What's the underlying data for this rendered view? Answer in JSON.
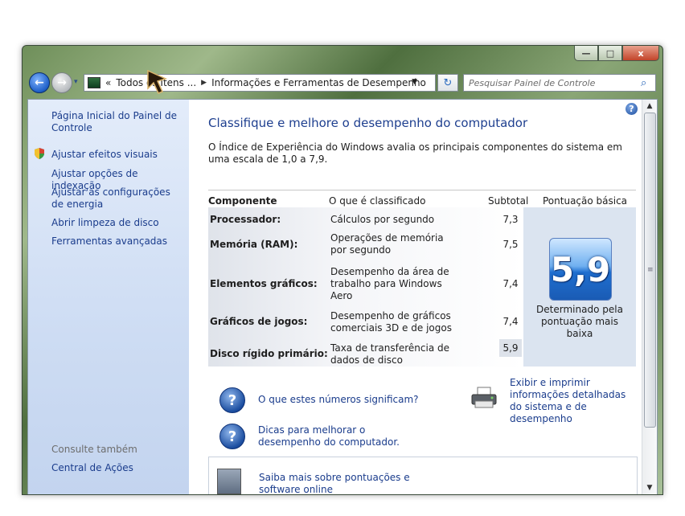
{
  "window": {
    "caption_buttons": {
      "minimize": "—",
      "maximize": "□",
      "close": "x"
    }
  },
  "navbar": {
    "back_icon": "back-arrow-icon",
    "forward_icon": "forward-arrow-icon",
    "breadcrumb_prefix": "«",
    "breadcrumb_root": "Todos os Itens ...",
    "breadcrumb_current": "Informações e Ferramentas de Desempenho",
    "search_placeholder": "Pesquisar Painel de Controle"
  },
  "sidebar": {
    "home_link": "Página Inicial do Painel de Controle",
    "tasks": [
      "Ajustar efeitos visuais",
      "Ajustar opções de indexação",
      "Ajustar as configurações de energia",
      "Abrir limpeza de disco",
      "Ferramentas avançadas"
    ],
    "see_also_heading": "Consulte também",
    "see_also": [
      "Central de Ações"
    ]
  },
  "main": {
    "title": "Classifique e melhore o desempenho do computador",
    "description": "O Índice de Experiência do Windows avalia os principais componentes do sistema em uma escala de 1,0 a 7,9.",
    "table": {
      "headers": {
        "component": "Componente",
        "rated": "O que é classificado",
        "subtotal": "Subtotal",
        "base_score": "Pontuação básica"
      },
      "rows": [
        {
          "component": "Processador:",
          "rated": "Cálculos por segundo",
          "subtotal": "7,3"
        },
        {
          "component": "Memória (RAM):",
          "rated": "Operações de memória por segundo",
          "subtotal": "7,5"
        },
        {
          "component": "Elementos gráficos:",
          "rated": "Desempenho da área de trabalho para Windows Aero",
          "subtotal": "7,4"
        },
        {
          "component": "Gráficos de jogos:",
          "rated": "Desempenho de gráficos comerciais 3D e de jogos",
          "subtotal": "7,4"
        },
        {
          "component": "Disco rígido primário:",
          "rated": "Taxa de transferência de dados de disco",
          "subtotal": "5,9"
        }
      ],
      "base_score": "5,9",
      "base_score_caption": "Determinado pela pontuação mais baixa"
    },
    "links": {
      "what_numbers_mean": "O que estes números significam?",
      "tips": "Dicas para melhorar o desempenho do computador.",
      "print_details": "Exibir e imprimir informações detalhadas do sistema e de desempenho",
      "learn_more": "Saiba mais sobre pontuações e software online"
    }
  },
  "colors": {
    "link": "#1a3c8c",
    "title": "#1e3f8f",
    "sidebar_top": "#e3ecfa",
    "score_tile": "#1f6fd0"
  }
}
